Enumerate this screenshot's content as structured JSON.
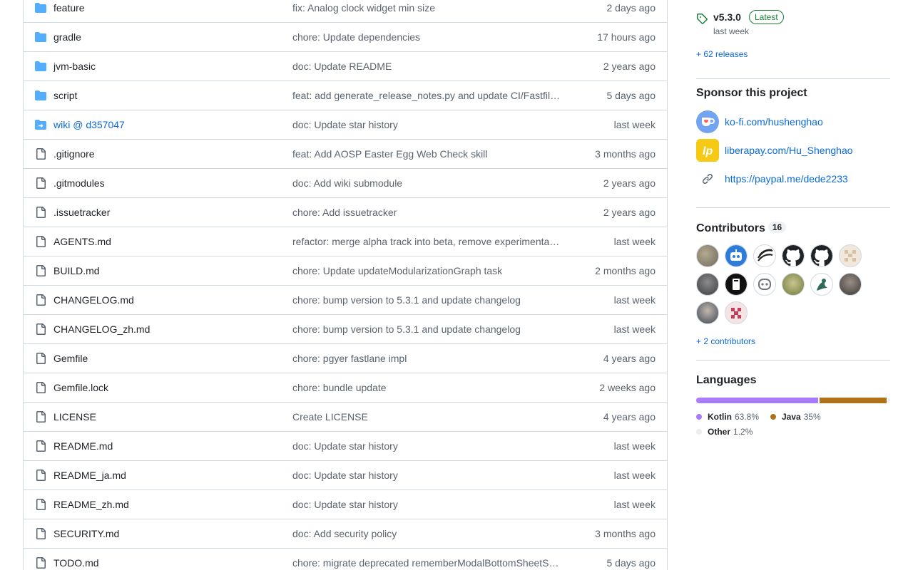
{
  "files": [
    {
      "name": "feature",
      "type": "folder",
      "message": "fix: Analog clock widget min size",
      "date": "2 days ago"
    },
    {
      "name": "gradle",
      "type": "folder",
      "message": "chore: Update dependencies",
      "date": "17 hours ago"
    },
    {
      "name": "jvm-basic",
      "type": "folder",
      "message": "doc: Update README",
      "date": "2 years ago"
    },
    {
      "name": "script",
      "type": "folder",
      "message": "feat: add generate_release_notes.py and update CI/Fastfil…",
      "date": "5 days ago"
    },
    {
      "name": "wiki @ d357047",
      "type": "submodule",
      "message": "doc: Update star history",
      "date": "last week"
    },
    {
      "name": ".gitignore",
      "type": "file",
      "message": "feat: Add AOSP Easter Egg Web Check skill",
      "date": "3 months ago"
    },
    {
      "name": ".gitmodules",
      "type": "file",
      "message": "doc: Add wiki submodule",
      "date": "2 years ago"
    },
    {
      "name": ".issuetracker",
      "type": "file",
      "message": "chore: Add issuetracker",
      "date": "2 years ago"
    },
    {
      "name": "AGENTS.md",
      "type": "file",
      "message": "refactor: merge alpha track into beta, remove experimenta…",
      "date": "last week"
    },
    {
      "name": "BUILD.md",
      "type": "file",
      "message": "chore: Update updateModularizationGraph task",
      "date": "2 months ago"
    },
    {
      "name": "CHANGELOG.md",
      "type": "file",
      "message": "chore: bump version to 5.3.1 and update changelog",
      "date": "last week"
    },
    {
      "name": "CHANGELOG_zh.md",
      "type": "file",
      "message": "chore: bump version to 5.3.1 and update changelog",
      "date": "last week"
    },
    {
      "name": "Gemfile",
      "type": "file",
      "message": "chore: pgyer fastlane impl",
      "date": "4 years ago"
    },
    {
      "name": "Gemfile.lock",
      "type": "file",
      "message": "chore: bundle update",
      "date": "2 weeks ago"
    },
    {
      "name": "LICENSE",
      "type": "file",
      "message": "Create LICENSE",
      "date": "4 years ago"
    },
    {
      "name": "README.md",
      "type": "file",
      "message": "doc: Update star history",
      "date": "last week"
    },
    {
      "name": "README_ja.md",
      "type": "file",
      "message": "doc: Update star history",
      "date": "last week"
    },
    {
      "name": "README_zh.md",
      "type": "file",
      "message": "doc: Update star history",
      "date": "last week"
    },
    {
      "name": "SECURITY.md",
      "type": "file",
      "message": "doc: Add security policy",
      "date": "3 months ago"
    },
    {
      "name": "TODO.md",
      "type": "file",
      "message": "chore: migrate deprecated rememberModalBottomSheetS…",
      "date": "5 days ago"
    }
  ],
  "release": {
    "version": "v5.3.0",
    "badge": "Latest",
    "when": "last week",
    "more": "+ 62 releases"
  },
  "sponsor": {
    "title": "Sponsor this project",
    "items": [
      {
        "label": "ko-fi.com/hushenghao",
        "icon": "kofi-icon"
      },
      {
        "label": "liberapay.com/Hu_Shenghao",
        "icon": "liberapay-icon"
      },
      {
        "label": "https://paypal.me/dede2233",
        "icon": "link-icon"
      }
    ]
  },
  "contributors": {
    "title": "Contributors",
    "count": "16",
    "more": "+ 2 contributors"
  },
  "languages": {
    "title": "Languages",
    "items": [
      {
        "name": "Kotlin",
        "pct": "63.8%",
        "value": 63.8,
        "color": "#A97BFF"
      },
      {
        "name": "Java",
        "pct": "35%",
        "value": 35,
        "color": "#b07219"
      },
      {
        "name": "Other",
        "pct": "1.2%",
        "value": 1.2,
        "color": "#ededed"
      }
    ]
  },
  "colors": {
    "link": "#0969da",
    "folder": "#54aeff",
    "latest": "#1a7f37"
  }
}
